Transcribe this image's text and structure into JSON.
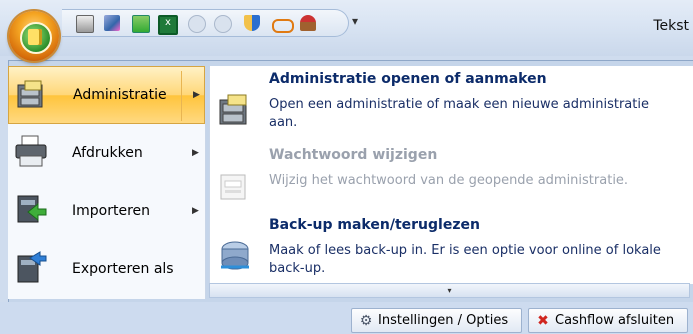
{
  "window": {
    "title": "Tekst"
  },
  "quick_access": {
    "icons": [
      "printer-icon",
      "paint-icon",
      "app-icon",
      "excel-icon",
      "back-icon",
      "forward-icon",
      "shield-icon",
      "glasses-icon",
      "plunger-icon"
    ],
    "more_label": "▾"
  },
  "menu": {
    "left_items": [
      {
        "label": "Administratie",
        "icon": "cabinet-icon",
        "has_submenu": true,
        "active": true
      },
      {
        "label": "Afdrukken",
        "icon": "printer-icon",
        "has_submenu": true,
        "active": false
      },
      {
        "label": "Importeren",
        "icon": "import-icon",
        "has_submenu": true,
        "active": false
      },
      {
        "label": "Exporteren als",
        "icon": "export-icon",
        "has_submenu": false,
        "active": false
      }
    ],
    "submenu_items": [
      {
        "title": "Administratie openen of aanmaken",
        "description": "Open een administratie of maak een nieuwe administratie aan.",
        "icon": "cabinet-icon",
        "enabled": true
      },
      {
        "title": "Wachtwoord wijzigen",
        "description": "Wijzig het wachtwoord van de geopende administratie.",
        "icon": "password-field-icon",
        "enabled": false
      },
      {
        "title": "Back-up maken/teruglezen",
        "description": "Maak of lees back-up in. Er is een optie voor online of lokale back-up.",
        "icon": "backup-icon",
        "enabled": true
      }
    ],
    "scroll_down_symbol": "▾"
  },
  "buttons": {
    "settings_label": "Instellingen / Opties",
    "close_label": "Cashflow afsluiten"
  },
  "colors": {
    "accent_active": "#ffd778",
    "title_text": "#0c2b6a",
    "disabled_text": "#9aa1ad"
  }
}
